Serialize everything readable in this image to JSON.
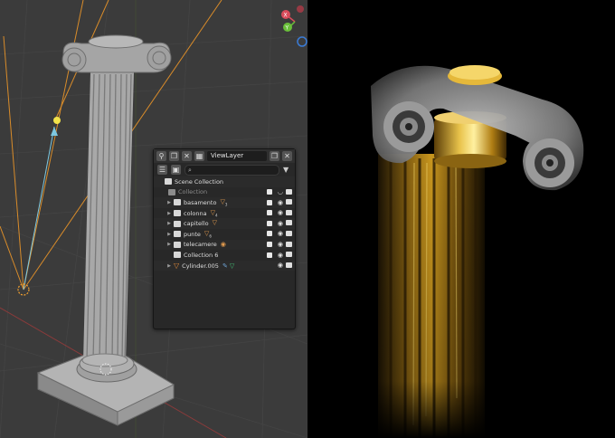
{
  "outliner": {
    "view_layer": "ViewLayer",
    "search_placeholder": "",
    "root": "Scene Collection",
    "rows": [
      {
        "label": "Collection",
        "dim": true,
        "type": "collection"
      },
      {
        "label": "basamento",
        "badge": "▽",
        "count": "3",
        "type": "collection"
      },
      {
        "label": "colonna",
        "badge": "▽",
        "count": "4",
        "type": "collection"
      },
      {
        "label": "capitello",
        "badge": "▽",
        "count": "",
        "type": "collection"
      },
      {
        "label": "punte",
        "badge": "▽",
        "count": "6",
        "type": "collection"
      },
      {
        "label": "telecamere",
        "badge": "◉",
        "count": "",
        "type": "collection"
      },
      {
        "label": "Collection 6",
        "badge": "",
        "count": "",
        "type": "collection"
      },
      {
        "label": "Cylinder.005",
        "badge": "",
        "count": "",
        "type": "object"
      }
    ]
  },
  "gizmo": {
    "x_label": "X",
    "y_label": "Y",
    "x_color": "#d94b5a",
    "y_color": "#6abf3a",
    "z_color": "#3a7bd5"
  },
  "colors": {
    "viewport_bg": "#3b3b3b",
    "panel_bg": "#282828",
    "accent_orange": "#e39b4e",
    "gold": "#c8961e"
  }
}
